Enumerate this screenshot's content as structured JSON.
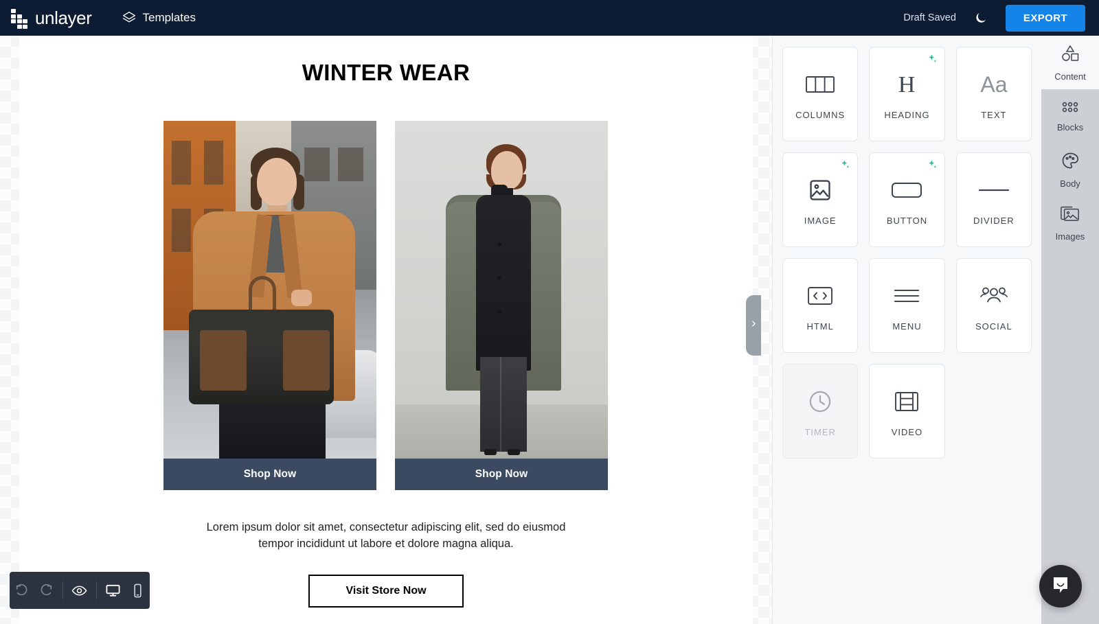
{
  "topbar": {
    "brand_name": "unlayer",
    "templates_label": "Templates",
    "draft_status": "Draft Saved",
    "dark_mode_icon": "moon-icon",
    "export_label": "EXPORT",
    "brand_bg": "#0d1b33",
    "export_color": "#1584e8"
  },
  "email": {
    "heading": "WINTER WEAR",
    "columns": [
      {
        "alt": "man-in-camel-coat-with-duffel-bag",
        "cta": "Shop Now"
      },
      {
        "alt": "woman-in-grey-long-coat",
        "cta": "Shop Now"
      }
    ],
    "paragraph": "Lorem ipsum dolor sit amet, consectetur adipiscing elit, sed do eiusmod tempor incididunt ut labore et dolore magna aliqua.",
    "cta_button": "Visit Store Now",
    "shopbar_color": "#3b4a60"
  },
  "devbar": {
    "buttons": [
      {
        "name": "undo",
        "icon": "undo-icon",
        "state": "disabled"
      },
      {
        "name": "redo",
        "icon": "redo-icon",
        "state": "disabled"
      },
      {
        "name": "preview",
        "icon": "eye-icon",
        "state": "enabled"
      },
      {
        "name": "desktop",
        "icon": "desktop-icon",
        "state": "active"
      },
      {
        "name": "mobile",
        "icon": "mobile-icon",
        "state": "enabled"
      }
    ]
  },
  "collapse_handle": {
    "icon": "chevron-right-icon"
  },
  "tools": {
    "items": [
      {
        "label": "COLUMNS",
        "icon": "columns-icon",
        "ai": false,
        "disabled": false
      },
      {
        "label": "HEADING",
        "icon": "heading-icon",
        "ai": true,
        "disabled": false
      },
      {
        "label": "TEXT",
        "icon": "text-icon",
        "ai": false,
        "disabled": false
      },
      {
        "label": "IMAGE",
        "icon": "image-icon",
        "ai": true,
        "disabled": false
      },
      {
        "label": "BUTTON",
        "icon": "button-icon",
        "ai": true,
        "disabled": false
      },
      {
        "label": "DIVIDER",
        "icon": "divider-icon",
        "ai": false,
        "disabled": false
      },
      {
        "label": "HTML",
        "icon": "code-icon",
        "ai": false,
        "disabled": false
      },
      {
        "label": "MENU",
        "icon": "menu-icon",
        "ai": false,
        "disabled": false
      },
      {
        "label": "SOCIAL",
        "icon": "social-icon",
        "ai": false,
        "disabled": false
      },
      {
        "label": "TIMER",
        "icon": "clock-icon",
        "ai": false,
        "disabled": true
      },
      {
        "label": "VIDEO",
        "icon": "video-icon",
        "ai": false,
        "disabled": false
      }
    ],
    "ai_badge_color": "#1fbf9c"
  },
  "side_tabs": {
    "items": [
      {
        "label": "Content",
        "icon": "shapes-icon",
        "active": true
      },
      {
        "label": "Blocks",
        "icon": "blocks-icon",
        "active": false
      },
      {
        "label": "Body",
        "icon": "palette-icon",
        "active": false
      },
      {
        "label": "Images",
        "icon": "images-icon",
        "active": false
      }
    ]
  },
  "chat": {
    "icon": "chat-bubble-icon"
  }
}
